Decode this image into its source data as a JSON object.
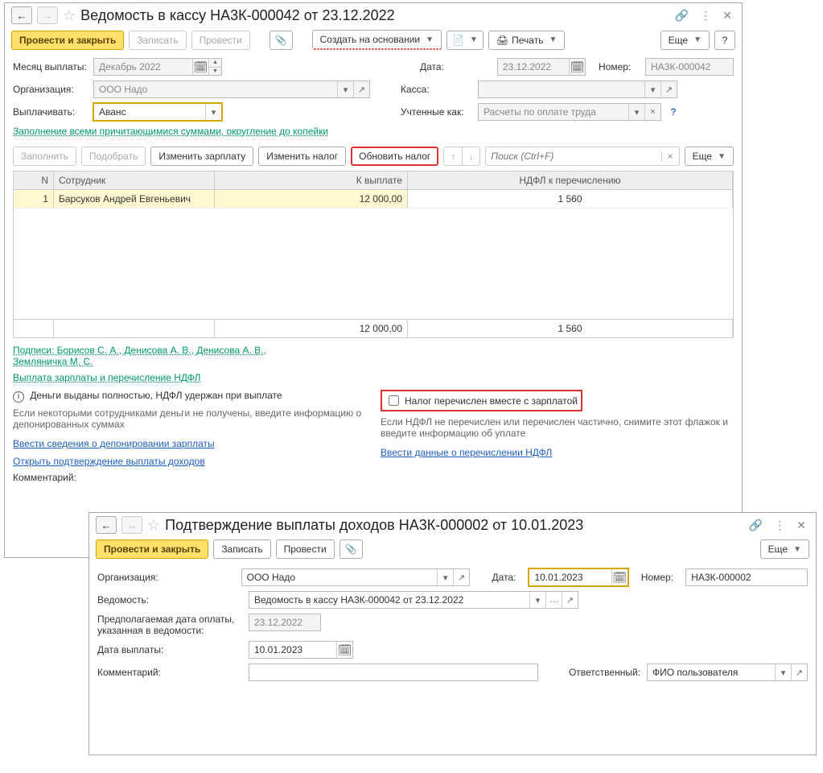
{
  "win1": {
    "title": "Ведомость в кассу НА3К-000042 от 23.12.2022",
    "toolbar": {
      "post_close": "Провести и закрыть",
      "write": "Записать",
      "post": "Провести",
      "create_based": "Создать на основании",
      "print": "Печать",
      "more": "Еще"
    },
    "labels": {
      "month": "Месяц выплаты:",
      "org": "Организация:",
      "pay": "Выплачивать:",
      "date": "Дата:",
      "number": "Номер:",
      "kassa": "Касса:",
      "uchten": "Учтенные как:"
    },
    "values": {
      "month": "Декабрь 2022",
      "org": "ООО Надо",
      "pay": "Аванс",
      "date": "23.12.2022",
      "number": "НА3К-000042",
      "kassa": "",
      "uchten": "Расчеты по оплате труда"
    },
    "green_link": "Заполнение всеми причитающимися суммами, округление до копейки",
    "subbar": {
      "fill": "Заполнить",
      "pick": "Подобрать",
      "edit_salary": "Изменить зарплату",
      "edit_tax": "Изменить налог",
      "refresh_tax": "Обновить налог",
      "search_ph": "Поиск (Ctrl+F)",
      "more": "Еще"
    },
    "grid": {
      "head_n": "N",
      "head_emp": "Сотрудник",
      "head_pay": "К выплате",
      "head_tax": "НДФЛ к перечислению",
      "row": {
        "n": "1",
        "emp": "Барсуков Андрей Евгеньевич",
        "pay": "12 000,00",
        "tax": "1 560"
      },
      "foot_pay": "12 000,00",
      "foot_tax": "1 560"
    },
    "signatures_link": "Подписи: Борисов С. А., Денисова А. В., Денисова А. В., Земляничка М. С.",
    "payout_link": "Выплата зарплаты и перечисление НДФЛ",
    "left_info": "Деньги выданы полностью, НДФЛ удержан при выплате",
    "left_note": "Если некоторыми сотрудниками деньги не получены, введите информацию о депонированных суммах",
    "left_link1": "Ввести сведения о депонировании зарплаты",
    "left_link2": "Открыть подтверждение выплаты доходов",
    "right_checkbox": "Налог перечислен вместе с зарплатой",
    "right_note": "Если НДФЛ не перечислен или перечислен частично, снимите этот флажок и введите информацию об уплате",
    "right_link": "Ввести данные о перечислении НДФЛ",
    "comment_label": "Комментарий:"
  },
  "win2": {
    "title": "Подтверждение выплаты доходов НА3К-000002 от 10.01.2023",
    "toolbar": {
      "post_close": "Провести и закрыть",
      "write": "Записать",
      "post": "Провести",
      "more": "Еще"
    },
    "labels": {
      "org": "Организация:",
      "ved": "Ведомость:",
      "plan_date": "Предполагаемая дата оплаты, указанная в ведомости:",
      "pay_date": "Дата выплаты:",
      "date": "Дата:",
      "number": "Номер:",
      "comment": "Комментарий:",
      "resp": "Ответственный:"
    },
    "values": {
      "org": "ООО Надо",
      "ved": "Ведомость в кассу НА3К-000042 от 23.12.2022",
      "plan_date": "23.12.2022",
      "pay_date": "10.01.2023",
      "date": "10.01.2023",
      "number": "НА3К-000002",
      "resp": "ФИО пользователя"
    }
  }
}
